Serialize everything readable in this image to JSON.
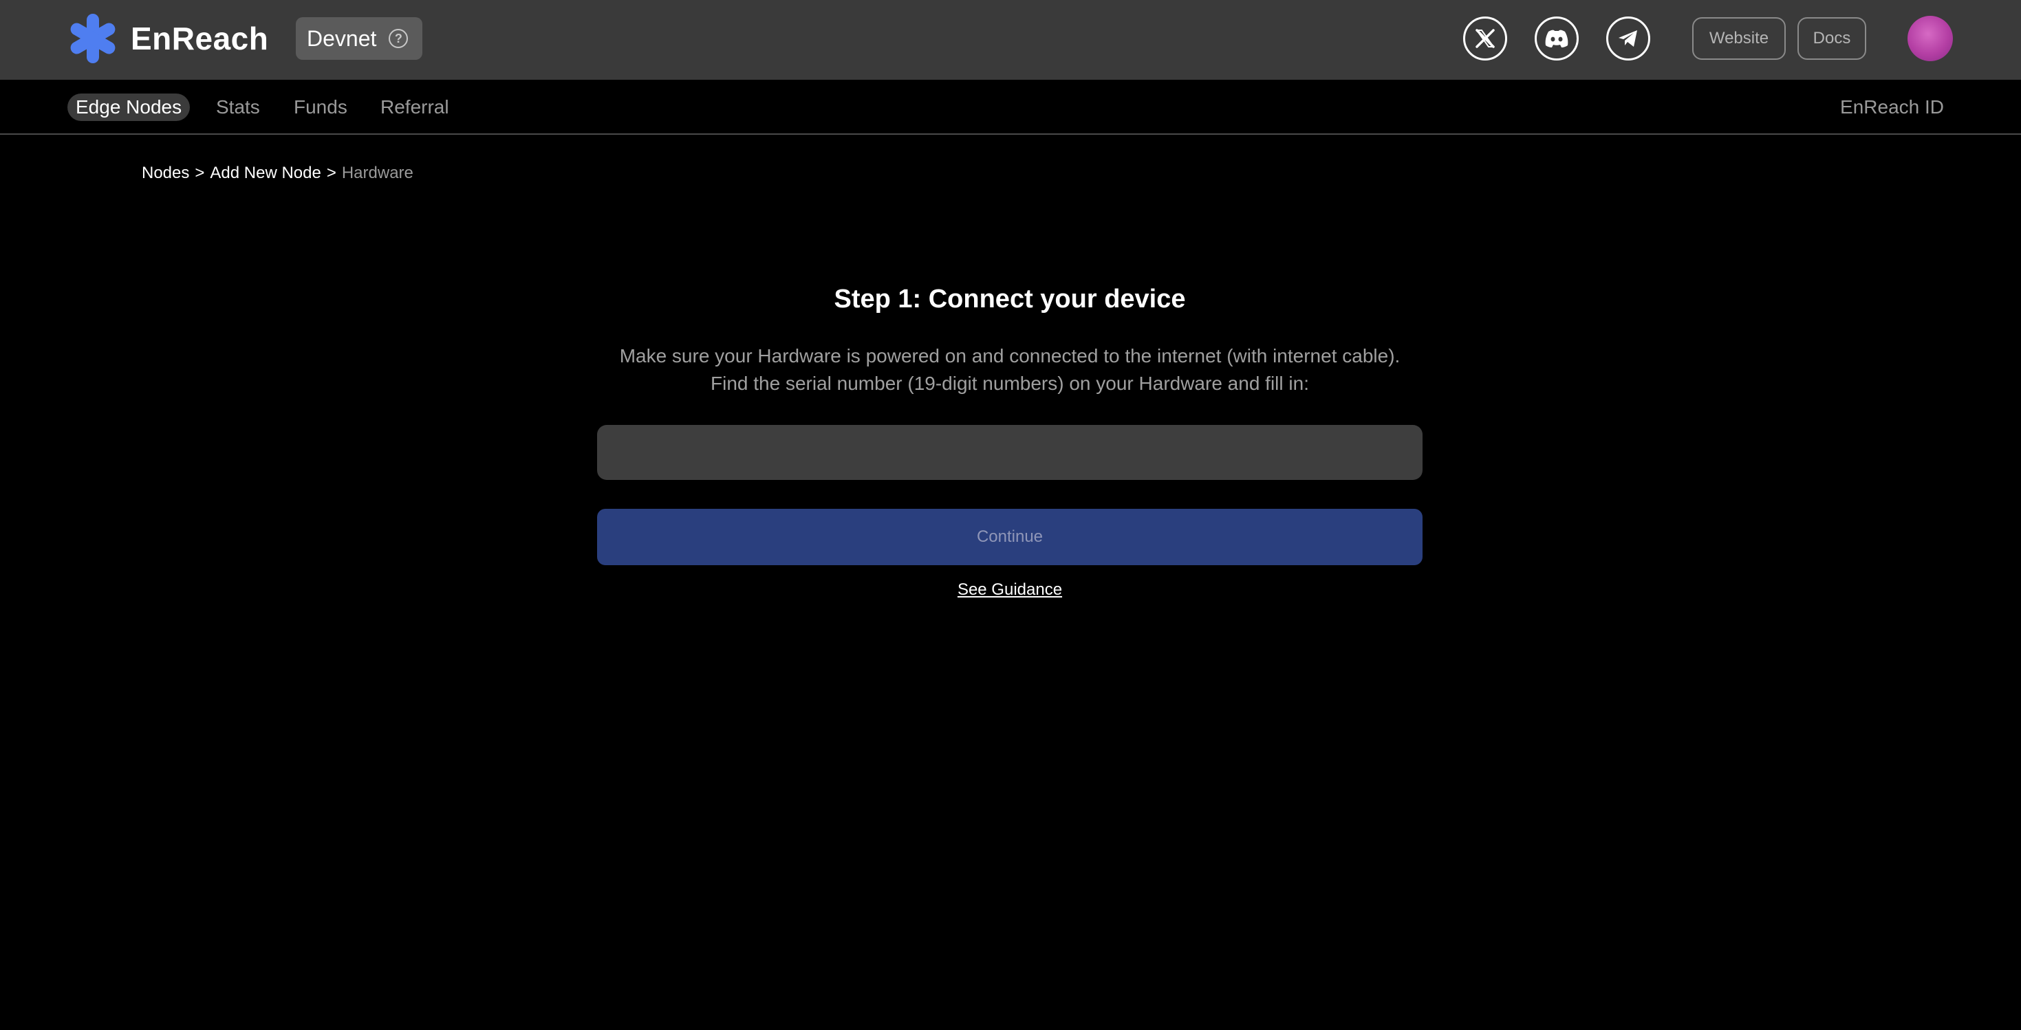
{
  "header": {
    "brand": "EnReach",
    "network": "Devnet",
    "help_glyph": "?",
    "social_icons": [
      "x-icon",
      "discord-icon",
      "telegram-icon"
    ],
    "website_label": "Website",
    "docs_label": "Docs",
    "accent_color": "#4f7ef0",
    "avatar_color": "#c24eb0"
  },
  "nav": {
    "items": [
      {
        "label": "Edge Nodes",
        "active": true
      },
      {
        "label": "Stats",
        "active": false
      },
      {
        "label": "Funds",
        "active": false
      },
      {
        "label": "Referral",
        "active": false
      }
    ],
    "right_label": "EnReach ID"
  },
  "breadcrumb": {
    "items": [
      "Nodes",
      "Add New Node",
      "Hardware"
    ],
    "separator": ">"
  },
  "main": {
    "title": "Step 1: Connect your device",
    "desc_line1": "Make sure your Hardware is powered on and connected to the internet (with internet cable).",
    "desc_line2": "Find the serial number (19-digit numbers) on your Hardware and fill in:",
    "serial_value": "",
    "serial_placeholder": "",
    "continue_label": "Continue",
    "guidance_label": "See Guidance"
  }
}
